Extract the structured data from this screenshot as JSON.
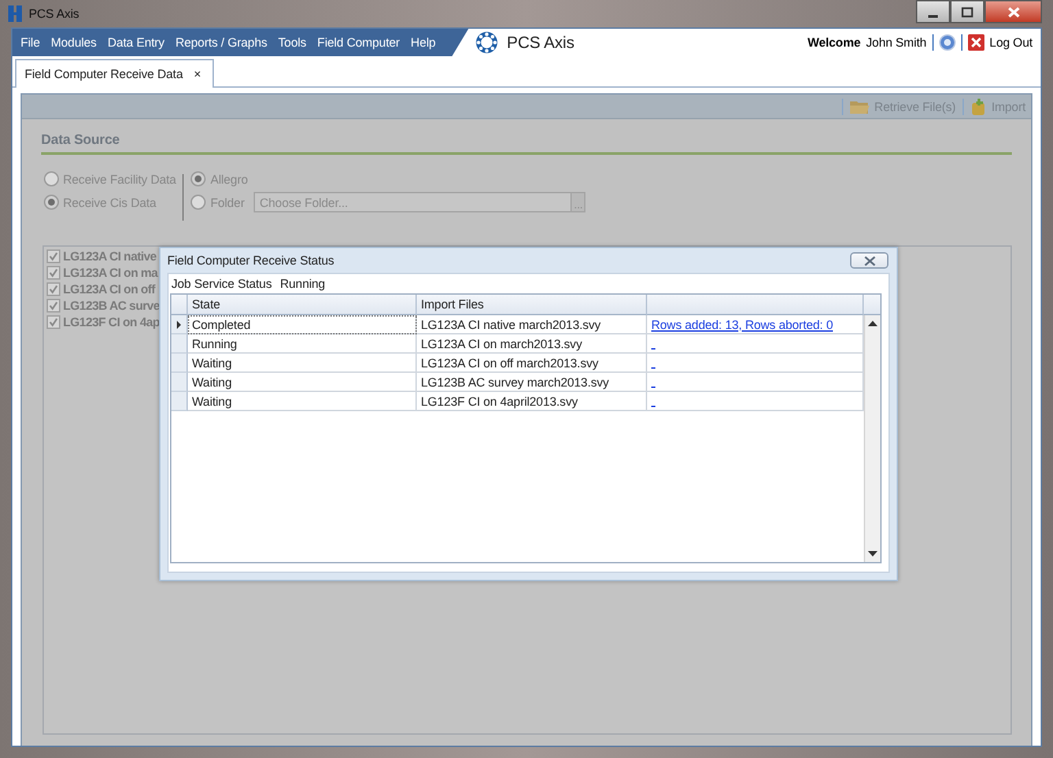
{
  "window": {
    "title": "PCS Axis"
  },
  "menu": [
    "File",
    "Modules",
    "Data Entry",
    "Reports / Graphs",
    "Tools",
    "Field Computer",
    "Help"
  ],
  "brand": "PCS Axis",
  "welcome": {
    "label": "Welcome",
    "user": "John Smith",
    "logout": "Log Out"
  },
  "tabs": [
    {
      "label": "Field Computer Receive Data",
      "close": "×",
      "selected": true
    }
  ],
  "toolbar": [
    "Retrieve File(s)",
    "Import"
  ],
  "data_source": {
    "title": "Data Source",
    "source_options": [
      {
        "label": "Receive Facility Data",
        "selected": false
      },
      {
        "label": "Receive Cis Data",
        "selected": true
      }
    ],
    "device_options": [
      {
        "label": "Allegro",
        "selected": true
      },
      {
        "label": "Folder",
        "selected": false
      }
    ],
    "folder_field": {
      "placeholder": "Choose Folder..."
    },
    "folder_button": "..."
  },
  "files": [
    {
      "label": "LG123A CI native",
      "checked": true
    },
    {
      "label": "LG123A CI on ma",
      "checked": true
    },
    {
      "label": "LG123A CI on off",
      "checked": true
    },
    {
      "label": "LG123B AC surve",
      "checked": true
    },
    {
      "label": "LG123F CI on 4ap",
      "checked": true
    }
  ],
  "dialog": {
    "title": "Field Computer Receive Status",
    "job_status_label": "Job Service Status",
    "job_status": "Running",
    "columns": [
      "State",
      "Import Files"
    ],
    "rows": [
      {
        "state": "Completed",
        "file": "LG123A CI native march2013.svy",
        "column_3": "Rows added: 13, Rows aborted: 0",
        "selected": true
      },
      {
        "state": "Running",
        "file": "LG123A CI on march2013.svy",
        "selected": false
      },
      {
        "state": "Waiting",
        "file": "LG123A CI on off march2013.svy",
        "selected": false
      },
      {
        "state": "Waiting",
        "file": "LG123B AC survey march2013.svy",
        "selected": false
      },
      {
        "state": "Waiting",
        "file": "LG123F CI on 4april2013.svy",
        "selected": false
      }
    ]
  }
}
